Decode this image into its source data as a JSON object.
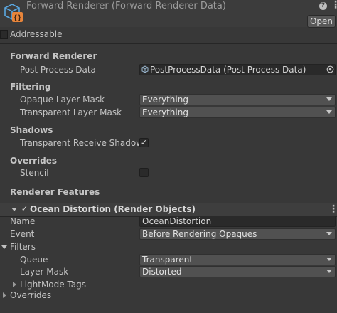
{
  "header": {
    "title": "Forward Renderer (Forward Renderer Data)",
    "open_label": "Open",
    "help_glyph": "?",
    "menu_glyph": "⋮",
    "icon": "scriptable-object-icon",
    "icon_glyph": "{}"
  },
  "addressable": {
    "label": "Addressable",
    "checked": false
  },
  "forward_renderer": {
    "heading": "Forward Renderer",
    "post_process_label": "Post Process Data",
    "post_process_value": "PostProcessData (Post Process Data)"
  },
  "filtering": {
    "heading": "Filtering",
    "opaque_label": "Opaque Layer Mask",
    "opaque_value": "Everything",
    "transparent_label": "Transparent Layer Mask",
    "transparent_value": "Everything"
  },
  "shadows": {
    "heading": "Shadows",
    "receive_label": "Transparent Receive Shadows",
    "receive_checked": true
  },
  "overrides": {
    "heading": "Overrides",
    "stencil_label": "Stencil",
    "stencil_checked": false
  },
  "renderer_features": {
    "heading": "Renderer Features",
    "feature": {
      "title": "Ocean Distortion (Render Objects)",
      "enabled": true,
      "menu_glyph": "⋮",
      "name_label": "Name",
      "name_value": "OceanDistortion",
      "event_label": "Event",
      "event_value": "Before Rendering Opaques",
      "filters_label": "Filters",
      "queue_label": "Queue",
      "queue_value": "Transparent",
      "layer_mask_label": "Layer Mask",
      "layer_mask_value": "Distorted",
      "lightmode_label": "LightMode Tags",
      "overrides_label": "Overrides"
    }
  },
  "check_glyph": "✓",
  "colors": {
    "background": "#383838",
    "field": "#2a2a2a",
    "dropdown": "#515151",
    "icon_blue": "#5aa7e0",
    "icon_orange": "#e8853b"
  }
}
